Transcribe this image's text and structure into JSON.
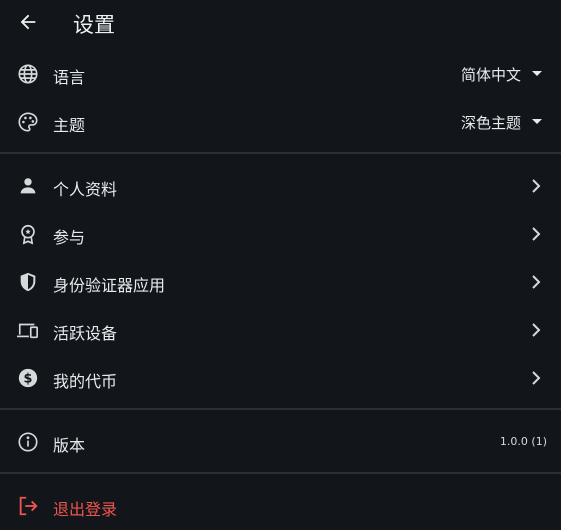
{
  "header": {
    "title": "设置",
    "back_icon": "arrow-left-icon"
  },
  "preferences": {
    "language": {
      "label": "语言",
      "value": "简体中文",
      "icon": "globe-icon"
    },
    "theme": {
      "label": "主题",
      "value": "深色主题",
      "icon": "palette-icon"
    }
  },
  "account": {
    "items": [
      {
        "label": "个人资料",
        "icon": "person-icon"
      },
      {
        "label": "参与",
        "icon": "award-badge-icon"
      },
      {
        "label": "身份验证器应用",
        "icon": "shield-icon"
      },
      {
        "label": "活跃设备",
        "icon": "devices-icon"
      },
      {
        "label": "我的代币",
        "icon": "dollar-coin-icon"
      }
    ]
  },
  "about": {
    "version_label": "版本",
    "version_value": "1.0.0 (1)",
    "icon": "info-icon"
  },
  "logout": {
    "label": "退出登录",
    "icon": "logout-icon",
    "color": "#f0544f"
  },
  "colors": {
    "background": "#12161b",
    "divider": "#2c3035",
    "text": "#e8eaed",
    "danger": "#f0544f"
  }
}
